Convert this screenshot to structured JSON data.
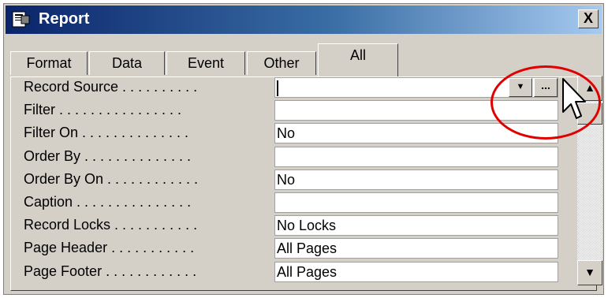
{
  "window": {
    "title": "Report",
    "close_label": "X"
  },
  "tabs": [
    {
      "label": "Format",
      "active": false
    },
    {
      "label": "Data",
      "active": false
    },
    {
      "label": "Event",
      "active": false
    },
    {
      "label": "Other",
      "active": false
    },
    {
      "label": "All",
      "active": true
    }
  ],
  "properties": [
    {
      "label": "Record Source . . . . . . . . . .",
      "value": ""
    },
    {
      "label": "Filter . . . . . . . . . . . . . . . .",
      "value": ""
    },
    {
      "label": "Filter On . . . . . . . . . . . . . .",
      "value": "No"
    },
    {
      "label": "Order By . . . . . . . . . . . . . .",
      "value": ""
    },
    {
      "label": "Order By On . . . . . . . . . . . .",
      "value": "No"
    },
    {
      "label": "Caption . . . . . . . . . . . . . . .",
      "value": ""
    },
    {
      "label": "Record Locks . . . . . . . . . . .",
      "value": "No Locks"
    },
    {
      "label": "Page Header . . . . . . . . . . .",
      "value": "All Pages"
    },
    {
      "label": "Page Footer . . . . . . . . . . . .",
      "value": "All Pages"
    }
  ],
  "icons": {
    "dropdown": "down-arrow-icon",
    "builder": "ellipsis-icon",
    "scroll_up": "up-arrow-icon",
    "scroll_down": "down-arrow-icon",
    "cursor": "mouse-pointer-icon"
  },
  "colors": {
    "title_bar": "#0a246a",
    "highlight_circle": "#e00000"
  }
}
